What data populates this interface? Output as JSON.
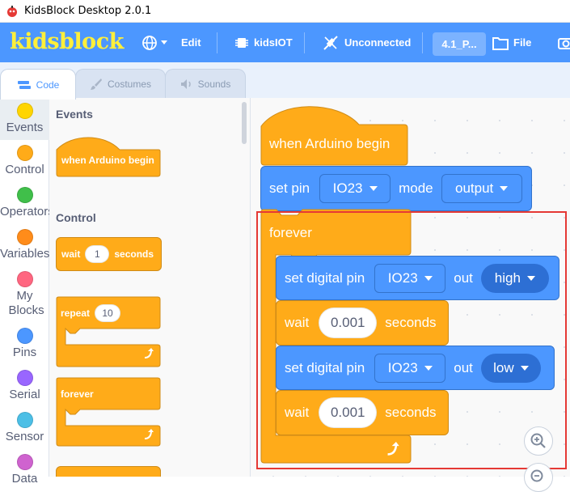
{
  "window": {
    "title": "KidsBlock Desktop 2.0.1"
  },
  "menubar": {
    "logo": "kidsblock",
    "edit": "Edit",
    "iot": "kidsIOT",
    "connection": "Unconnected",
    "project": "4.1_P...",
    "file": "File",
    "colors": {
      "bar": "#4c97ff",
      "logo": "#ffef3a"
    }
  },
  "tabs": [
    {
      "label": "Code",
      "icon": "code-icon"
    },
    {
      "label": "Costumes",
      "icon": "brush-icon"
    },
    {
      "label": "Sounds",
      "icon": "speaker-icon"
    }
  ],
  "categories": [
    {
      "label": "Events",
      "color": "#ffd500"
    },
    {
      "label": "Control",
      "color": "#ffab19"
    },
    {
      "label": "Operators",
      "color": "#40bf4a"
    },
    {
      "label": "Variables",
      "color": "#ff8c1a"
    },
    {
      "label": "My Blocks",
      "color": "#ff6680"
    },
    {
      "label": "Pins",
      "color": "#4c97ff"
    },
    {
      "label": "Serial",
      "color": "#9966ff"
    },
    {
      "label": "Sensor",
      "color": "#4cbfe6"
    },
    {
      "label": "Data",
      "color": "#cf63cf"
    }
  ],
  "palette": {
    "events_heading": "Events",
    "when_arduino_begin": "when Arduino begin",
    "control_heading": "Control",
    "wait_label": "wait",
    "wait_value": "1",
    "seconds_label": "seconds",
    "repeat_label": "repeat",
    "repeat_value": "10",
    "forever_label": "forever"
  },
  "script": {
    "hat": "when Arduino begin",
    "set_pin": "set pin",
    "pin_a": "IO23",
    "mode_label": "mode",
    "mode_value": "output",
    "forever": "forever",
    "set_digital_pin": "set digital pin",
    "pin_b": "IO23",
    "out_label": "out",
    "level_high": "high",
    "wait_label": "wait",
    "wait_value_1": "0.001",
    "seconds_label": "seconds",
    "set_digital_pin_2": "set digital pin",
    "pin_c": "IO23",
    "out_label_2": "out",
    "level_low": "low",
    "wait_label_2": "wait",
    "wait_value_2": "0.001",
    "seconds_label_2": "seconds"
  }
}
